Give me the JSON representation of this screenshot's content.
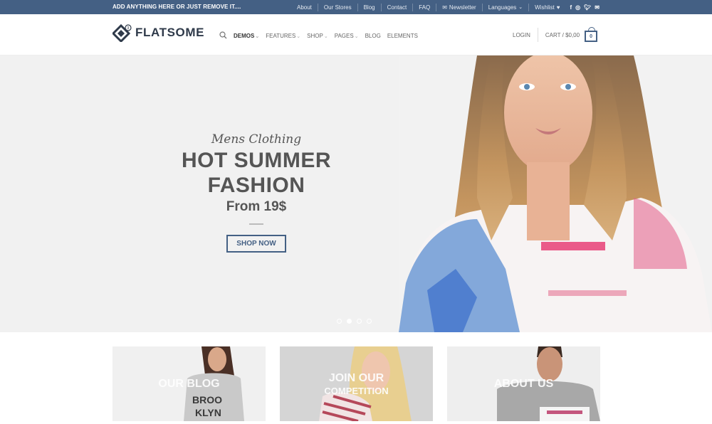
{
  "topbar": {
    "promo": "ADD ANYTHING HERE OR JUST REMOVE IT....",
    "links": [
      "About",
      "Our Stores",
      "Blog",
      "Contact",
      "FAQ"
    ],
    "newsletter": "Newsletter",
    "languages": "Languages",
    "wishlist": "Wishlist",
    "social": [
      "facebook-icon",
      "instagram-icon",
      "twitter-icon",
      "email-icon"
    ]
  },
  "header": {
    "logo": "FLATSOME",
    "nav": [
      {
        "label": "DEMOS",
        "dropdown": true,
        "active": true
      },
      {
        "label": "FEATURES",
        "dropdown": true
      },
      {
        "label": "SHOP",
        "dropdown": true
      },
      {
        "label": "PAGES",
        "dropdown": true
      },
      {
        "label": "BLOG",
        "dropdown": false
      },
      {
        "label": "ELEMENTS",
        "dropdown": false
      }
    ],
    "login": "LOGIN",
    "cart": "CART / $0,00",
    "cart_count": "0"
  },
  "hero": {
    "script": "Mens Clothing",
    "title_line1": "HOT SUMMER",
    "title_line2": "FASHION",
    "price": "From 19$",
    "button": "SHOP NOW",
    "slides": 4,
    "active_slide": 2
  },
  "promo_boxes": [
    {
      "title": "OUR BLOG",
      "subtitle": ""
    },
    {
      "title": "JOIN OUR",
      "subtitle": "COMPETITION"
    },
    {
      "title": "ABOUT US",
      "subtitle": ""
    }
  ],
  "colors": {
    "primary": "#446084",
    "hero_bg": "#f1f1f1"
  }
}
